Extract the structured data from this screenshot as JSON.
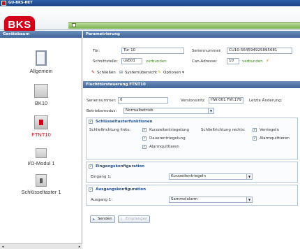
{
  "window": {
    "title": "GU-BKS-NET"
  },
  "logo": {
    "text": "BKS",
    "color": "#d4001a"
  },
  "sidebar": {
    "header": "Gerätebaum",
    "items": [
      {
        "label": "Allgemein",
        "icon": "door-icon"
      },
      {
        "label": "BK10",
        "icon": "device-box-icon"
      },
      {
        "label": "FTNT10",
        "icon": "module-icon",
        "selected": true
      },
      {
        "label": "I/O-Modul 1",
        "icon": "io-module-icon"
      },
      {
        "label": "Schlüsseltaster 1",
        "icon": "key-switch-icon"
      }
    ]
  },
  "param": {
    "header": "Parametrierung",
    "tuer_label": "Tür:",
    "tuer_value": "Tür 10",
    "serial_label": "Seriennummer:",
    "serial_value": "CU10-564594925895681",
    "port_label": "Schnittstelle:",
    "port_value": "usb01",
    "port_status": "verbunden",
    "can_label": "Can-Adresse:",
    "can_value": "10",
    "can_status": "verbunden",
    "toolbar": {
      "close_label": "Schließen",
      "overview_label": "Systemübersicht",
      "options_label": "Optionen ▾"
    }
  },
  "ftnt": {
    "header": "Fluchttürsteuerung FTNT10",
    "serial_label": "Seriennummer:",
    "serial_value": "0",
    "version_label": "Versionsinfo:",
    "version_value": "HW:001 FW:179",
    "last_change_label": "Letzte Änderung:",
    "mode_label": "Betriebsmodus:",
    "mode_value": "Normalbetrieb"
  },
  "keyswitch": {
    "title": "Schlüsseltasterfunktionen",
    "left_label": "Schließrichtung links:",
    "left_options": [
      "Kurzzeitentriegelung",
      "Dauerentriegelung",
      "Alarmquittieren"
    ],
    "right_label": "Schließrichtung rechts:",
    "right_options": [
      "Verriegeln",
      "Alarmquittieren"
    ]
  },
  "input_config": {
    "title": "Eingangskonfiguration",
    "input_label": "Eingang 1:",
    "input_value": "Kurzzeitentriegeln"
  },
  "output_config": {
    "title": "Ausgangskonfiguration",
    "output_label": "Ausgang 1:",
    "output_value": "Sammelalarm"
  },
  "footer": {
    "send_label": "Senden",
    "receive_label": "Empfangen"
  },
  "colors": {
    "header": "#3e6499",
    "accent_red": "#d00018",
    "status_green": "#3a8a1a"
  }
}
